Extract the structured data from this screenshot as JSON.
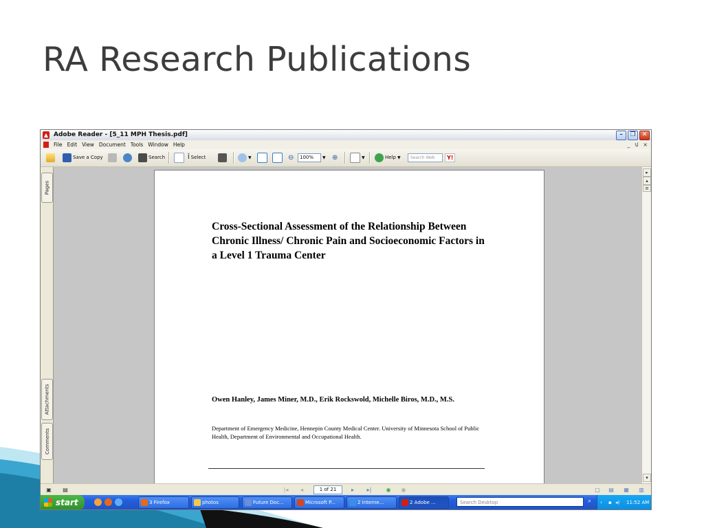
{
  "slide": {
    "title": "RA Research Publications"
  },
  "window": {
    "title": "Adobe Reader - [5_11 MPH Thesis.pdf]"
  },
  "menu": {
    "items": [
      "File",
      "Edit",
      "View",
      "Document",
      "Tools",
      "Window",
      "Help"
    ],
    "doc_controls": [
      "_",
      "ป",
      "×"
    ]
  },
  "toolbar": {
    "save_copy_label": "Save a Copy",
    "search_label": "Search",
    "select_label": "Select",
    "zoom_value": "100%",
    "help_label": "Help",
    "search_web_placeholder": "Search Web",
    "yahoo_label": "Y!"
  },
  "side_panel": {
    "tabs": [
      "Pages",
      "Attachments",
      "Comments"
    ]
  },
  "document": {
    "title": "Cross-Sectional Assessment of the Relationship Between Chronic Illness/ Chronic Pain and Socioeconomic Factors in a Level 1 Trauma Center",
    "authors": "Owen Hanley, James Miner, M.D., Erik Rockswold, Michelle Biros, M.D., M.S.",
    "affiliation": "Department of Emergency Medicine, Hennepin County Medical Center. University of Minnesota School of Public Health, Department of Environmental and Occupational Health."
  },
  "status": {
    "page_indicator": "1 of 21"
  },
  "taskbar": {
    "start_label": "start",
    "tasks": [
      {
        "label": "3 Firefox",
        "icon": "firefox-icon",
        "color": "#e66a1a"
      },
      {
        "label": "photos",
        "icon": "folder-icon",
        "color": "#f2c94c"
      },
      {
        "label": "Future Doc...",
        "icon": "document-icon",
        "color": "#6a8fd8"
      },
      {
        "label": "Microsoft P...",
        "icon": "powerpoint-icon",
        "color": "#d24726"
      },
      {
        "label": "2 Interne...",
        "icon": "internet-explorer-icon",
        "color": "#3b8ee8"
      },
      {
        "label": "2 Adobe ...",
        "icon": "adobe-reader-icon",
        "color": "#d11f16"
      }
    ],
    "search_placeholder": "Search Desktop",
    "clock": "11:52 AM"
  },
  "colors": {
    "title_text": "#3d3d3d",
    "taskbar_blue": "#245edb",
    "start_green": "#3a9d36",
    "doc_gray": "#c6c6c6",
    "swoosh_teal": "#1e7fa6"
  }
}
